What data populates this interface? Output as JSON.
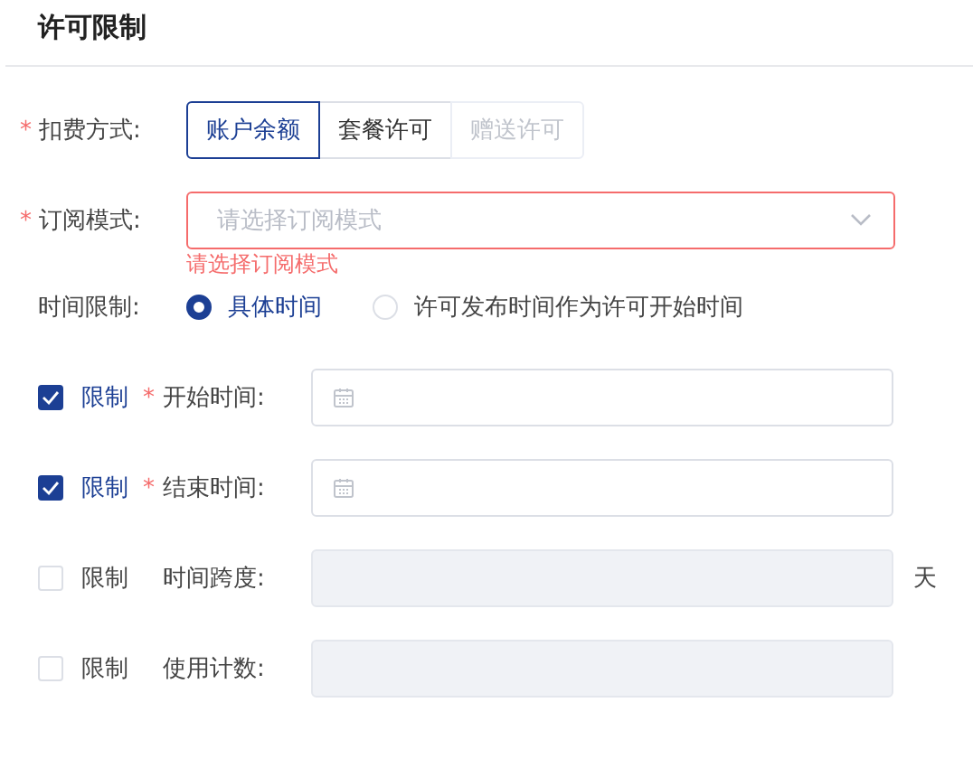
{
  "title": "许可限制",
  "billing": {
    "required_mark": "*",
    "label": "扣费方式:",
    "options": [
      {
        "label": "账户余额",
        "selected": true,
        "disabled": false
      },
      {
        "label": "套餐许可",
        "selected": false,
        "disabled": false
      },
      {
        "label": "赠送许可",
        "selected": false,
        "disabled": true
      }
    ]
  },
  "subscription": {
    "required_mark": "*",
    "label": "订阅模式:",
    "placeholder": "请选择订阅模式",
    "error": "请选择订阅模式"
  },
  "time_limit": {
    "label": "时间限制:",
    "options": [
      {
        "label": "具体时间",
        "selected": true
      },
      {
        "label": "许可发布时间作为许可开始时间",
        "selected": false
      }
    ]
  },
  "limits": [
    {
      "check_label": "限制",
      "checked": true,
      "required_mark": "*",
      "label": "开始时间:",
      "kind": "date",
      "disabled": false
    },
    {
      "check_label": "限制",
      "checked": true,
      "required_mark": "*",
      "label": "结束时间:",
      "kind": "date",
      "disabled": false
    },
    {
      "check_label": "限制",
      "checked": false,
      "label": "时间跨度:",
      "kind": "text",
      "disabled": true,
      "suffix": "天"
    },
    {
      "check_label": "限制",
      "checked": false,
      "label": "使用计数:",
      "kind": "text",
      "disabled": true
    }
  ]
}
